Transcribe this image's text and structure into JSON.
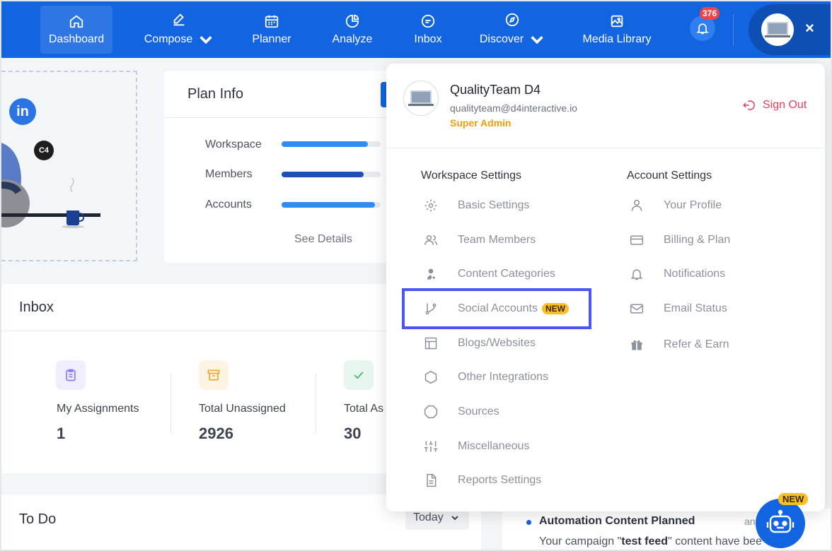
{
  "nav": {
    "items": [
      {
        "label": "Dashboard",
        "icon": "home-icon"
      },
      {
        "label": "Compose",
        "icon": "pen-icon"
      },
      {
        "label": "Planner",
        "icon": "calendar-icon"
      },
      {
        "label": "Analyze",
        "icon": "pie-chart-icon"
      },
      {
        "label": "Inbox",
        "icon": "chat-icon"
      },
      {
        "label": "Discover",
        "icon": "compass-icon"
      },
      {
        "label": "Media Library",
        "icon": "image-icon"
      }
    ],
    "notification_count": "376",
    "close_symbol": "×",
    "accent": "#1264e0"
  },
  "plan_info": {
    "title": "Plan Info",
    "rows": [
      {
        "label": "Workspace",
        "usage": 0.87
      },
      {
        "label": "Members",
        "usage": 0.83
      },
      {
        "label": "Accounts",
        "usage": 0.94
      }
    ],
    "see_details": "See Details"
  },
  "inbox": {
    "title": "Inbox",
    "stats": [
      {
        "label": "My Assignments",
        "value": "1"
      },
      {
        "label": "Total Unassigned",
        "value": "2926"
      },
      {
        "label": "Total As",
        "value": "30"
      }
    ]
  },
  "todo": {
    "title": "To Do",
    "filter": "Today"
  },
  "notification": {
    "title": "Automation Content Planned",
    "time": "an",
    "body_prefix": "Your campaign \"",
    "body_bold": "test feed",
    "body_suffix": "\" content have bee"
  },
  "profile": {
    "name": "QualityTeam D4",
    "email": "qualityteam@d4interactive.io",
    "role": "Super Admin",
    "sign_out": "Sign Out"
  },
  "workspace_settings": {
    "heading": "Workspace Settings",
    "items": [
      {
        "label": "Basic Settings",
        "icon": "gear-icon"
      },
      {
        "label": "Team Members",
        "icon": "users-icon"
      },
      {
        "label": "Content Categories",
        "icon": "categories-icon"
      },
      {
        "label": "Social Accounts",
        "icon": "branch-icon",
        "badge": "NEW"
      },
      {
        "label": "Blogs/Websites",
        "icon": "layout-icon"
      },
      {
        "label": "Other Integrations",
        "icon": "hexagon-icon"
      },
      {
        "label": "Sources",
        "icon": "octagon-icon"
      },
      {
        "label": "Miscellaneous",
        "icon": "sliders-icon"
      },
      {
        "label": "Reports Settings",
        "icon": "document-icon"
      }
    ]
  },
  "account_settings": {
    "heading": "Account Settings",
    "items": [
      {
        "label": "Your Profile",
        "icon": "user-icon"
      },
      {
        "label": "Billing & Plan",
        "icon": "credit-card-icon"
      },
      {
        "label": "Notifications",
        "icon": "bell-icon"
      },
      {
        "label": "Email Status",
        "icon": "mail-icon"
      },
      {
        "label": "Refer & Earn",
        "icon": "gift-icon"
      }
    ]
  },
  "bot": {
    "badge": "NEW"
  }
}
